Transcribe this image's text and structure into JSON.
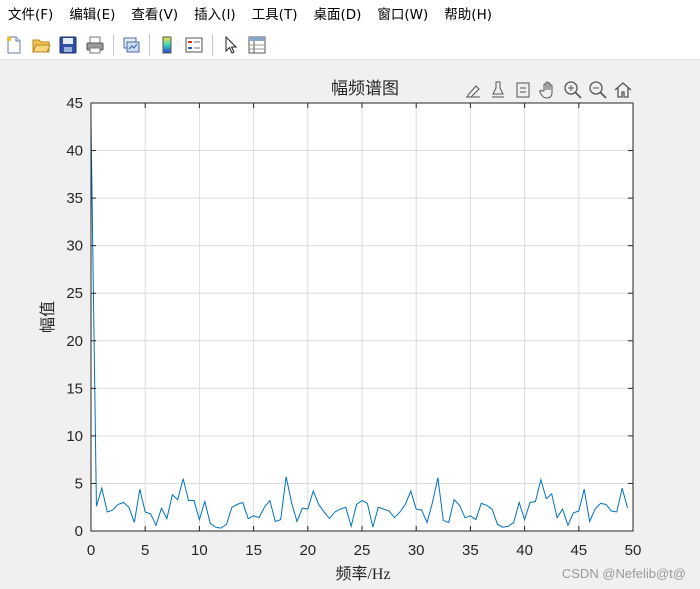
{
  "menubar": {
    "items": [
      "文件(F)",
      "编辑(E)",
      "查看(V)",
      "插入(I)",
      "工具(T)",
      "桌面(D)",
      "窗口(W)",
      "帮助(H)"
    ]
  },
  "toolbar": {
    "buttons": [
      "new-file-icon",
      "open-folder-icon",
      "save-icon",
      "print-icon",
      "link-plot-icon",
      "colorbar-icon",
      "legend-icon",
      "pointer-icon",
      "property-inspector-icon"
    ]
  },
  "axes_toolbar": {
    "buttons": [
      "brush-icon",
      "data-tips-icon",
      "export-icon",
      "pan-icon",
      "zoom-in-icon",
      "zoom-out-icon",
      "home-icon"
    ]
  },
  "watermark": "CSDN @Nefelib@t@",
  "chart_data": {
    "type": "line",
    "title": "幅频谱图",
    "xlabel": "频率/Hz",
    "ylabel": "幅值",
    "xlim": [
      0,
      50
    ],
    "ylim": [
      0,
      45
    ],
    "xticks": [
      0,
      5,
      10,
      15,
      20,
      25,
      30,
      35,
      40,
      45,
      50
    ],
    "yticks": [
      0,
      5,
      10,
      15,
      20,
      25,
      30,
      35,
      40,
      45
    ],
    "grid": true,
    "line_color": "#0072bd",
    "series": [
      {
        "x": [
          0,
          0.5,
          1,
          1.5,
          2,
          2.5,
          3,
          3.5,
          4,
          4.5,
          5,
          5.5,
          6,
          6.5,
          7,
          7.5,
          8,
          8.5,
          9,
          9.5,
          10,
          10.5,
          11,
          11.5,
          12,
          12.5,
          13,
          13.5,
          14,
          14.5,
          15,
          15.5,
          16,
          16.5,
          17,
          17.5,
          18,
          18.5,
          19,
          19.5,
          20,
          20.5,
          21,
          21.5,
          22,
          22.5,
          23,
          23.5,
          24,
          24.5,
          25,
          25.5,
          26,
          26.5,
          27,
          27.5,
          28,
          28.5,
          29,
          29.5,
          30,
          30.5,
          31,
          31.5,
          32,
          32.5,
          33,
          33.5,
          34,
          34.5,
          35,
          35.5,
          36,
          36.5,
          37,
          37.5,
          38,
          38.5,
          39,
          39.5,
          40,
          40.5,
          41,
          41.5,
          42,
          42.5,
          43,
          43.5,
          44,
          44.5,
          45,
          45.5,
          46,
          46.5,
          47,
          47.5,
          48,
          48.5,
          49,
          49.5
        ],
        "values": [
          43.0,
          2.6,
          4.5,
          2.0,
          2.2,
          2.8,
          3.0,
          2.5,
          0.9,
          4.4,
          2.0,
          1.8,
          0.6,
          2.4,
          1.3,
          3.8,
          3.3,
          5.5,
          3.2,
          3.2,
          1.2,
          3.1,
          0.8,
          0.4,
          0.3,
          0.7,
          2.5,
          2.8,
          3.0,
          1.3,
          1.6,
          1.4,
          2.5,
          3.2,
          1.0,
          1.2,
          5.7,
          3.0,
          1.0,
          2.4,
          2.3,
          4.2,
          2.8,
          2.0,
          1.3,
          2.0,
          2.3,
          2.5,
          0.5,
          2.8,
          3.2,
          2.9,
          0.4,
          2.5,
          2.3,
          2.1,
          1.4,
          2.0,
          2.8,
          4.2,
          2.3,
          2.2,
          0.9,
          3.0,
          5.6,
          1.1,
          0.9,
          3.3,
          2.7,
          1.4,
          1.6,
          1.2,
          2.9,
          2.7,
          2.3,
          0.7,
          0.4,
          0.5,
          0.9,
          3.0,
          1.2,
          3.0,
          3.1,
          5.4,
          3.4,
          3.9,
          1.4,
          2.3,
          0.6,
          1.9,
          2.1,
          4.4,
          1.0,
          2.3,
          2.9,
          2.8,
          2.1,
          2.0,
          4.5,
          2.4
        ]
      }
    ]
  }
}
